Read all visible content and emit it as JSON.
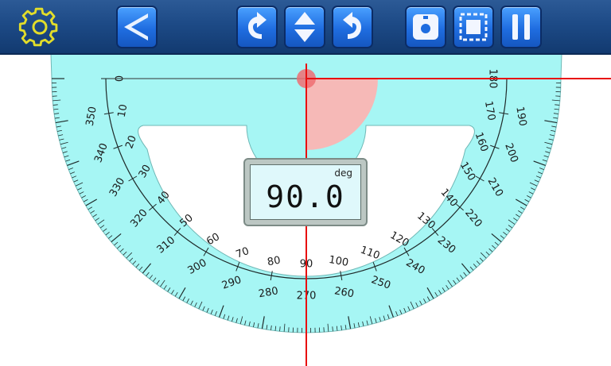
{
  "toolbar": {
    "buttons": [
      {
        "name": "settings-button",
        "icon": "gear-icon"
      },
      {
        "name": "collapse-button",
        "icon": "angle-left-icon"
      },
      {
        "name": "rotate-left-button",
        "icon": "rotate-left-icon"
      },
      {
        "name": "flip-button",
        "icon": "up-down-arrows-icon"
      },
      {
        "name": "rotate-right-button",
        "icon": "rotate-right-icon"
      },
      {
        "name": "camera-button",
        "icon": "camera-icon"
      },
      {
        "name": "crop-button",
        "icon": "crop-frame-icon"
      },
      {
        "name": "pause-button",
        "icon": "pause-icon"
      }
    ]
  },
  "protractor": {
    "inner_scale": [
      "0",
      "10",
      "20",
      "30",
      "40",
      "50",
      "60",
      "70",
      "80",
      "90",
      "100",
      "110",
      "120",
      "130",
      "140",
      "150",
      "160",
      "170",
      "180"
    ],
    "outer_scale": [
      "350",
      "340",
      "330",
      "320",
      "310",
      "300",
      "290",
      "280",
      "270",
      "260",
      "250",
      "240",
      "230",
      "220",
      "210",
      "200",
      "190"
    ]
  },
  "readout": {
    "value": "90.0",
    "unit": "deg"
  },
  "colors": {
    "protractor_fill": "#a6f6f4",
    "tick": "#1f2a2a",
    "crosshair": "#e81010",
    "angle_sector": "#ffb3b0",
    "toolbar": "#1d4a86",
    "button": "#1f6de0"
  }
}
